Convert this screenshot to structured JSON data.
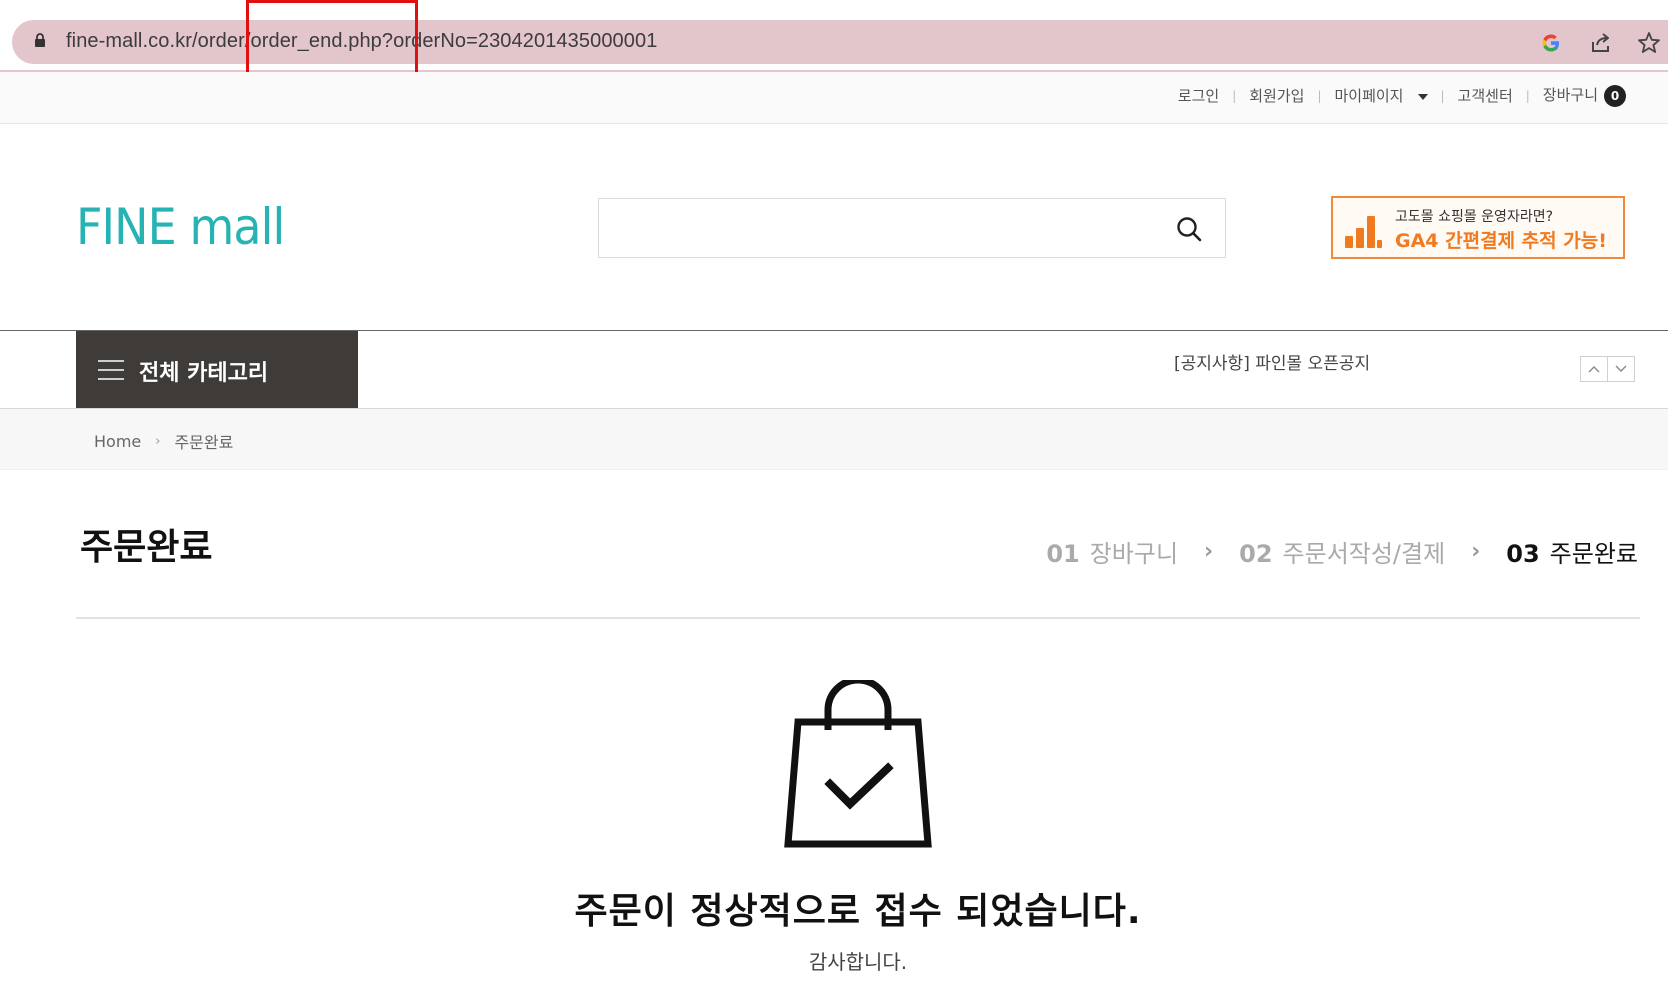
{
  "browser": {
    "url_host": "fine-mall.co.kr",
    "url_path": "/order/order_end.php",
    "url_query": "?orderNo=2304201435000001",
    "icons": [
      "lock-icon",
      "google-icon",
      "share-icon",
      "star-icon"
    ]
  },
  "util_menu": {
    "login": "로그인",
    "signup": "회원가입",
    "mypage": "마이페이지",
    "customer_center": "고객센터",
    "cart": "장바구니",
    "cart_count": "0"
  },
  "header": {
    "logo": "FINE mall",
    "search_placeholder": "",
    "ad": {
      "line1": "고도몰 쇼핑몰 운영자라면?",
      "line2": "GA4 간편결제 추적 가능!"
    }
  },
  "nav": {
    "category_label": "전체 카테고리",
    "notice": "[공지사항] 파인몰 오픈공지"
  },
  "breadcrumb": {
    "home": "Home",
    "current": "주문완료"
  },
  "page": {
    "title": "주문완료",
    "steps": [
      {
        "num": "01",
        "label": "장바구니",
        "active": false
      },
      {
        "num": "02",
        "label": "주문서작성/결제",
        "active": false
      },
      {
        "num": "03",
        "label": "주문완료",
        "active": true
      }
    ]
  },
  "completion": {
    "message": "주문이 정상적으로 접수 되었습니다.",
    "thanks": "감사합니다."
  },
  "colors": {
    "brand": "#27b3b3",
    "address_bar": "#e3c5cc",
    "category_bg": "#3f3b39",
    "ad_accent": "#f07a20",
    "highlight_box": "#e01010"
  }
}
